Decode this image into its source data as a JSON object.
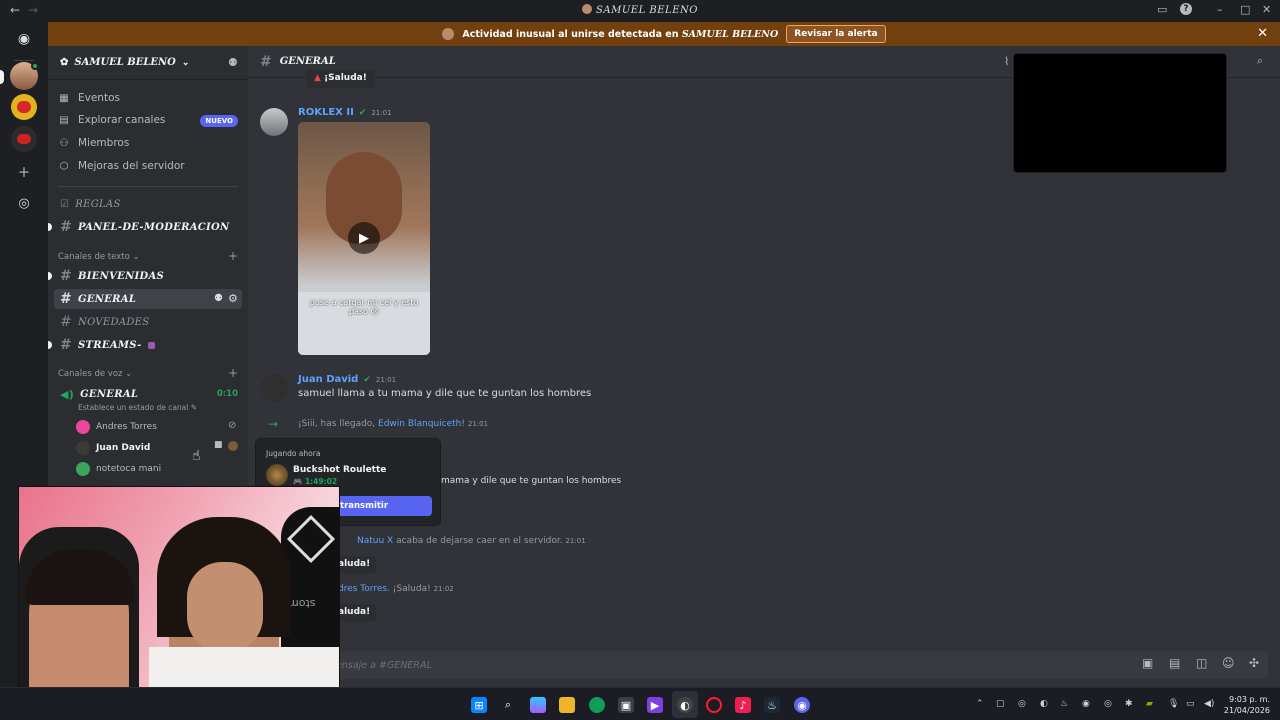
{
  "window": {
    "title": "SAMUEL BELENO"
  },
  "alert": {
    "text": "Actividad inusual al unirse detectada en",
    "server": "SAMUEL BELENO",
    "button": "Revisar la alerta"
  },
  "server": {
    "name": "SAMUEL BELENO"
  },
  "nav": [
    {
      "label": "Eventos",
      "icon": "calendar-icon"
    },
    {
      "label": "Explorar canales",
      "icon": "browse-icon",
      "badge": "NUEVO"
    },
    {
      "label": "Miembros",
      "icon": "members-icon"
    },
    {
      "label": "Mejoras del servidor",
      "icon": "boost-icon"
    }
  ],
  "channels_top": [
    {
      "name": "REGLAS",
      "icon": "rules-icon"
    },
    {
      "name": "PANEL-DE-MODERACION",
      "icon": "hash-icon"
    }
  ],
  "text_category": "Canales de texto",
  "text_channels": [
    {
      "name": "BIENVENIDAS"
    },
    {
      "name": "GENERAL"
    },
    {
      "name": "NOVEDADES"
    },
    {
      "name": "STREAMS-"
    }
  ],
  "voice_category": "Canales de voz",
  "voice_channel": {
    "name": "GENERAL",
    "time": "0:10",
    "status": "Establece un estado de canal"
  },
  "voice_users": [
    "Andres Torres",
    "Juan David",
    "notetoca mani"
  ],
  "chat": {
    "channel": "GENERAL",
    "top_partial": "¡Saluda!",
    "messages": [
      {
        "user": "ROKLEX II",
        "time": "21:01",
        "caption": "puse a cargar mi cel y esto paso 😢"
      },
      {
        "user": "Juan David",
        "time": "21:01",
        "text": "samuel llama a tu mama y dile que te guntan los hombres"
      }
    ],
    "sys1": {
      "pre": "¡Siii, has llegado, ",
      "user": "Edwin Blanquiceth",
      "post": "!",
      "time": "21:01"
    },
    "reply_text": "mama y dile que te guntan los hombres",
    "sys2": {
      "user": "Natuu X",
      "text": "acaba de dejarse caer en el servidor.",
      "time": "21:01"
    },
    "saluda1": "aluda!",
    "sys3": {
      "user": "dres Torres.",
      "text": "¡Saluda!",
      "time": "21:02"
    },
    "saluda2": "aluda!",
    "input_placeholder": "ensaje a #GENERAL"
  },
  "popup": {
    "heading": "Jugando ahora",
    "game": "Buckshot Roulette",
    "elapsed": "1:49:02",
    "button": "transmitir"
  },
  "webcam": {
    "brand": "stomp"
  },
  "clock": {
    "time": "9:03 p. m.",
    "date": "21/04/2026"
  }
}
